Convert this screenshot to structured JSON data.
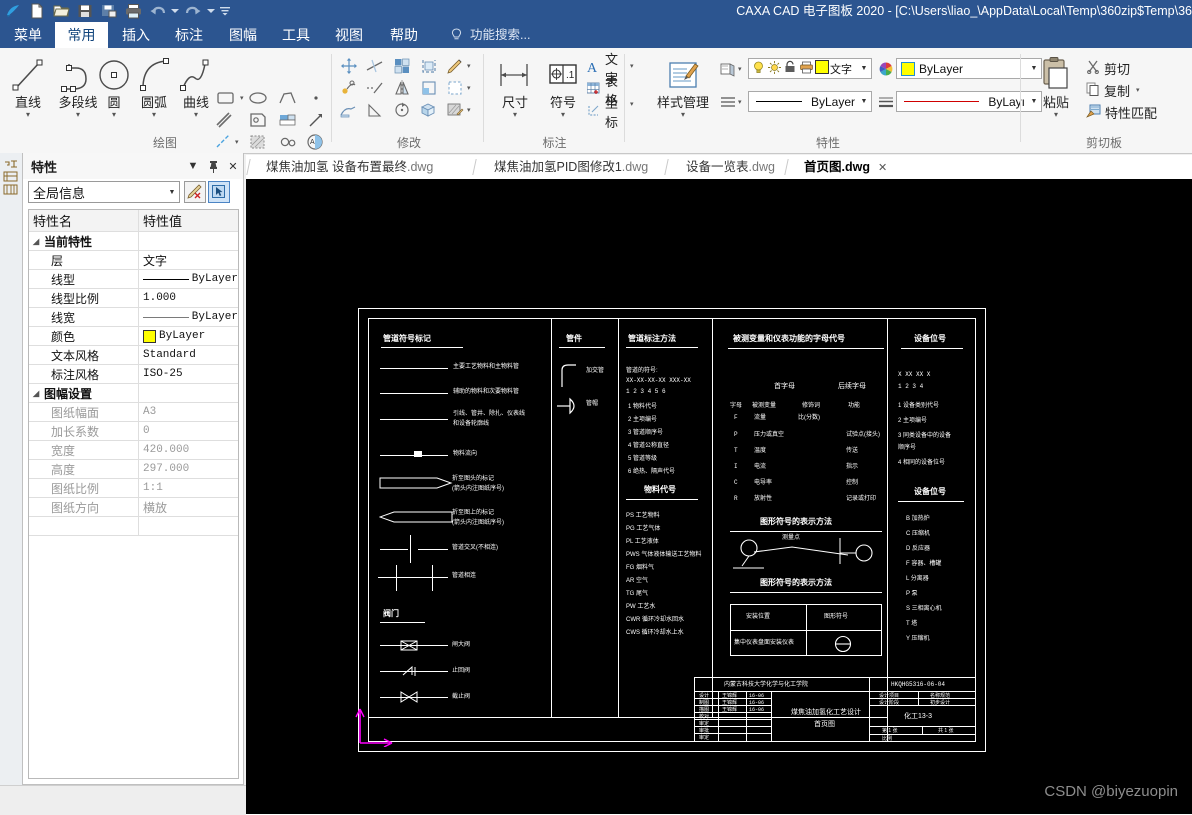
{
  "window": {
    "title": "CAXA CAD 电子图板 2020 - [C:\\Users\\liao_\\AppData\\Local\\Temp\\360zip$Temp\\36",
    "quick_access": [
      "new-icon",
      "open-icon",
      "save-icon",
      "save-as-icon",
      "print-icon",
      "undo-icon",
      "undo-dropdown-icon",
      "redo-icon",
      "redo-dropdown-icon",
      "customize-qat-icon"
    ]
  },
  "menu": {
    "tabs": [
      {
        "label": "菜单",
        "active": false
      },
      {
        "label": "常用",
        "active": true
      },
      {
        "label": "插入",
        "active": false
      },
      {
        "label": "标注",
        "active": false
      },
      {
        "label": "图幅",
        "active": false
      },
      {
        "label": "工具",
        "active": false
      },
      {
        "label": "视图",
        "active": false
      },
      {
        "label": "帮助",
        "active": false
      }
    ],
    "search_placeholder": "功能搜索..."
  },
  "ribbon": {
    "groups": [
      {
        "name": "绘图",
        "title": "绘图",
        "big_buttons": [
          {
            "label": "直线",
            "icon": "line-icon"
          },
          {
            "label": "多段线",
            "icon": "polyline-icon"
          },
          {
            "label": "圆",
            "icon": "circle-icon"
          },
          {
            "label": "圆弧",
            "icon": "arc-icon"
          },
          {
            "label": "曲线",
            "icon": "spline-icon"
          }
        ],
        "small_icons": [
          "rectangle-icon",
          "ellipse-icon",
          "polygon-icon",
          "point-icon",
          "centerline-icon",
          "local-view-icon",
          "block-icon",
          "arrow-icon",
          "construction-line-icon",
          "hatch-region-icon",
          "gear-icon",
          "text-fill-icon"
        ]
      },
      {
        "name": "修改",
        "title": "修改",
        "small_icons": [
          "move-icon",
          "trim-icon",
          "array-icon",
          "copy-shape-icon",
          "chamfer-pencil-icon",
          "rotate-copy-icon",
          "extend-icon",
          "mirror-icon",
          "corner-icon",
          "scale-frame-icon",
          "stretch-icon",
          "break-icon",
          "rotate-icon",
          "explode-icon",
          "edit-hatch-icon"
        ]
      },
      {
        "name": "标注",
        "title": "标注",
        "big_buttons": [
          {
            "label": "尺寸",
            "icon": "dimension-icon"
          },
          {
            "label": "符号",
            "icon": "symbol-icon"
          }
        ],
        "text_buttons": [
          {
            "label": "文字",
            "icon": "text-icon"
          },
          {
            "label": "表格",
            "icon": "table-icon"
          },
          {
            "label": "坐标",
            "icon": "coordinate-icon"
          }
        ]
      },
      {
        "name": "特性",
        "title": "特性",
        "big_buttons": [
          {
            "label": "样式管理",
            "icon": "style-manager-icon"
          }
        ],
        "layer_icons": [
          "layer-on-icon",
          "layer-freeze-icon",
          "layer-lock-icon",
          "layer-print-icon",
          "layer-color-icon",
          "layer-text-icon"
        ],
        "combos": [
          {
            "name": "layer-combo",
            "value": "ByLayer",
            "icon": "color-wheel-icon",
            "swatch": "#ffff00"
          },
          {
            "name": "linetype-combo",
            "value": "ByLayer",
            "icon": "linetype-icon"
          },
          {
            "name": "lineweight-combo",
            "value": "ByLayı",
            "icon": "lineweight-icon"
          }
        ]
      },
      {
        "name": "剪切板",
        "title": "剪切板",
        "big_buttons": [
          {
            "label": "粘贴",
            "icon": "paste-icon"
          }
        ],
        "text_buttons": [
          {
            "label": "剪切",
            "icon": "cut-icon"
          },
          {
            "label": "复制",
            "icon": "copy-icon"
          },
          {
            "label": "特性匹配",
            "icon": "match-properties-icon"
          }
        ]
      }
    ]
  },
  "property_panel": {
    "title": "特性",
    "header_buttons": [
      "dropdown-icon",
      "pin-icon",
      "close-icon"
    ],
    "selector_value": "全局信息",
    "tools": [
      "clear-selection-icon",
      "pick-selection-icon"
    ],
    "columns": [
      "特性名",
      "特性值"
    ],
    "sections": [
      {
        "name": "当前特性",
        "rows": [
          {
            "name": "层",
            "value": "文字",
            "type": "text"
          },
          {
            "name": "线型",
            "value": "ByLayer",
            "type": "linetype"
          },
          {
            "name": "线型比例",
            "value": "1.000",
            "type": "text"
          },
          {
            "name": "线宽",
            "value": "ByLayer",
            "type": "lineweight"
          },
          {
            "name": "颜色",
            "value": "ByLayer",
            "type": "color",
            "swatch": "#ffff00"
          },
          {
            "name": "文本风格",
            "value": "Standard",
            "type": "text"
          },
          {
            "name": "标注风格",
            "value": "ISO-25",
            "type": "text"
          }
        ]
      },
      {
        "name": "图幅设置",
        "disabled": true,
        "rows": [
          {
            "name": "图纸幅面",
            "value": "A3",
            "type": "text"
          },
          {
            "name": "加长系数",
            "value": "0",
            "type": "text"
          },
          {
            "name": "宽度",
            "value": "420.000",
            "type": "text"
          },
          {
            "name": "高度",
            "value": "297.000",
            "type": "text"
          },
          {
            "name": "图纸比例",
            "value": "1:1",
            "type": "text"
          },
          {
            "name": "图纸方向",
            "value": "横放",
            "type": "text"
          }
        ]
      }
    ]
  },
  "document_tabs": [
    {
      "name": "煤焦油加氢 设备布置最终",
      "ext": ".dwg",
      "active": false
    },
    {
      "name": "煤焦油加氢PID图修改1",
      "ext": ".dwg",
      "active": false
    },
    {
      "name": "设备一览表",
      "ext": ".dwg",
      "active": false
    },
    {
      "name": "首页图",
      "ext": ".dwg",
      "active": true
    }
  ],
  "drawing": {
    "watermark": "CSDN @biyezuopin",
    "ucs_indicator": "ucs-axis-icon",
    "legend_pipe": {
      "title": "管道符号标记",
      "entries": [
        "主要工艺物料和主物料管",
        "辅助的物料和次要物料管",
        "引线、管井、除扎、仪表线",
        "和设备轮廓线",
        "物料流向",
        "折至图头的标记",
        "(箭头内注图纸序号)",
        "折至图上的标记",
        "(箭头内注图纸序号)",
        "管道交叉(不相连)",
        "管道相连"
      ],
      "sub_title": "阀门",
      "valves": [
        "闸大阀",
        "止回阀",
        "截止阀"
      ]
    },
    "legend_fittings": {
      "title": "管件",
      "entries": [
        "加交管",
        "管帽"
      ]
    },
    "legend_pipe_label": {
      "title": "管道标注方法",
      "lines": [
        "管道的符号:",
        "XX-XX-XX-XX XXX-XX",
        "1  2  3  4  5  6",
        "1 物料代号",
        "2 主项编号",
        "3 管道顺序号",
        "4 管道公称直径",
        "5 管道等级",
        "6 绝热、隔声代号"
      ],
      "sub_title": "物料代号",
      "codes": [
        "PS 工艺物料",
        "PG 工艺气体",
        "PL 工艺液体",
        "PWS 气体液体输送工艺物料",
        "FG 烟料气",
        "AR 空气",
        "TG 尾气",
        "PW 工艺水",
        "CWR 循环冷却水回水",
        "CWS 循环冷却水上水"
      ]
    },
    "legend_instrument": {
      "title": "被测变量和仪表功能的字母代号",
      "head1": "首字母",
      "head2": "后续字母",
      "col_labels": [
        "字母",
        "被测变量",
        "修饰词",
        "功能"
      ],
      "rows": [
        {
          "letter": "F",
          "variable": "流量",
          "modifier": "比(分数)",
          "function": ""
        },
        {
          "letter": "P",
          "variable": "压力或真空",
          "modifier": "",
          "function": "试验点(接头)"
        },
        {
          "letter": "T",
          "variable": "温度",
          "modifier": "",
          "function": "传送"
        },
        {
          "letter": "I",
          "variable": "电流",
          "modifier": "",
          "function": "指示"
        },
        {
          "letter": "C",
          "variable": "电导率",
          "modifier": "",
          "function": "控制"
        },
        {
          "letter": "R",
          "variable": "放射性",
          "modifier": "",
          "function": "记录或打印"
        }
      ],
      "sub_title1": "图形符号的表示方法",
      "measure_label": "测量点",
      "sub_title2": "图形符号的表示方法",
      "table_head": [
        "安装位置",
        "图形符号"
      ],
      "table_row": [
        "集中仪表盘面安装仪表",
        "circle-symbol"
      ]
    },
    "legend_equipment": {
      "title": "设备位号",
      "format": "X  XX XX X",
      "format_idx": "1   2  3  4",
      "rows": [
        "1 设备类别代号",
        "2 主项编号",
        "3 同类设备中的设备",
        "   顺序号",
        "4 相同的设备位号"
      ],
      "sub_title": "设备位号",
      "codes": [
        "B 加热炉",
        "C 压缩机",
        "D 反应器",
        "F 容器、槽罐",
        "L 分离器",
        "P 泵",
        "S 三相离心机",
        "T 塔",
        "Y 压缩机"
      ]
    },
    "title_block": {
      "org": "内蒙古科技大学化学与化工学院",
      "drawing_no": "HKQHG5316-06-04",
      "project": "煤焦油加氢化工艺设计",
      "sheet": "首页图",
      "class": "化工13-3",
      "roles": [
        "设计",
        "制图",
        "描图",
        "校对",
        "审定",
        "审批",
        "审定"
      ],
      "signer": "王锦辉",
      "dates": [
        "16-06",
        "16-06",
        "16-06"
      ],
      "right_labels": [
        "设计项目",
        "名称规范",
        "设计阶段",
        "初步设计",
        "第 1 张",
        "共 1 张",
        "比例"
      ]
    }
  }
}
